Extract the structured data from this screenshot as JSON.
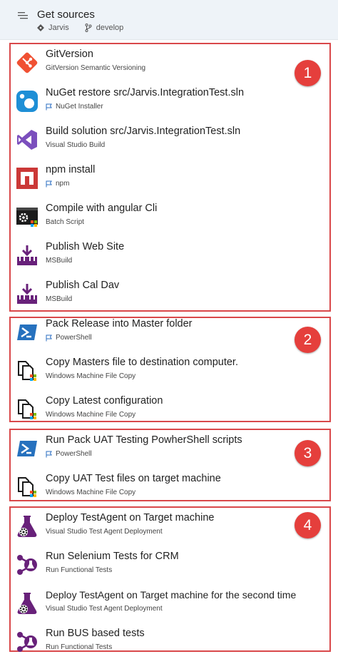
{
  "header": {
    "title": "Get sources",
    "repo": "Jarvis",
    "branch": "develop",
    "icon": "list-icon"
  },
  "colors": {
    "badge": "#e53f3c",
    "border": "#d9484a",
    "header_bg": "#eef3f8"
  },
  "groups": [
    {
      "badge": "1",
      "tasks": [
        {
          "name": "GitVersion",
          "sub": "GitVersion Semantic Versioning",
          "icon": "git-icon",
          "flag": false
        },
        {
          "name": "NuGet restore src/Jarvis.IntegrationTest.sln",
          "sub": "NuGet Installer",
          "icon": "nuget-icon",
          "flag": true
        },
        {
          "name": "Build solution src/Jarvis.IntegrationTest.sln",
          "sub": "Visual Studio Build",
          "icon": "visual-studio-icon",
          "flag": false
        },
        {
          "name": "npm install",
          "sub": "npm",
          "icon": "npm-icon",
          "flag": true
        },
        {
          "name": "Compile with angular Cli",
          "sub": "Batch Script",
          "icon": "batch-script-icon",
          "flag": false
        },
        {
          "name": "Publish Web Site",
          "sub": "MSBuild",
          "icon": "msbuild-icon",
          "flag": false
        },
        {
          "name": "Publish Cal Dav",
          "sub": "MSBuild",
          "icon": "msbuild-icon",
          "flag": false
        }
      ]
    },
    {
      "badge": "2",
      "tasks": [
        {
          "name": "Pack Release into Master folder",
          "sub": "PowerShell",
          "icon": "powershell-icon",
          "flag": true
        },
        {
          "name": "Copy Masters file to destination computer.",
          "sub": "Windows Machine File Copy",
          "icon": "file-copy-icon",
          "flag": false
        },
        {
          "name": "Copy Latest configuration",
          "sub": "Windows Machine File Copy",
          "icon": "file-copy-icon",
          "flag": false
        }
      ]
    },
    {
      "badge": "3",
      "tasks": [
        {
          "name": "Run Pack UAT Testing PowherShell scripts",
          "sub": "PowerShell",
          "icon": "powershell-icon",
          "flag": true
        },
        {
          "name": "Copy UAT Test files on target machine",
          "sub": "Windows Machine File Copy",
          "icon": "file-copy-icon",
          "flag": false
        }
      ]
    },
    {
      "badge": "4",
      "tasks": [
        {
          "name": "Deploy TestAgent on Target machine",
          "sub": "Visual Studio Test Agent Deployment",
          "icon": "test-agent-icon",
          "flag": false
        },
        {
          "name": "Run Selenium Tests for CRM",
          "sub": "Run Functional Tests",
          "icon": "functional-tests-icon",
          "flag": false
        },
        {
          "name": "Deploy TestAgent on Target machine for the second time",
          "sub": "Visual Studio Test Agent Deployment",
          "icon": "test-agent-icon",
          "flag": false
        },
        {
          "name": "Run BUS based tests",
          "sub": "Run Functional Tests",
          "icon": "functional-tests-icon",
          "flag": false
        }
      ]
    }
  ]
}
